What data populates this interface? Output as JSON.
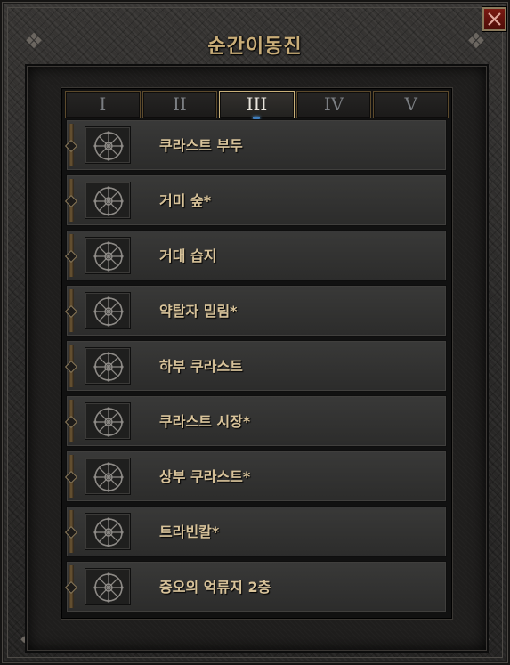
{
  "window": {
    "title": "순간이동진",
    "close_label": "×"
  },
  "tabs": [
    {
      "label": "I",
      "active": false
    },
    {
      "label": "II",
      "active": false
    },
    {
      "label": "III",
      "active": true
    },
    {
      "label": "IV",
      "active": false
    },
    {
      "label": "V",
      "active": false
    }
  ],
  "waypoints": [
    {
      "label": "쿠라스트 부두",
      "icon": "waypoint-icon"
    },
    {
      "label": "거미 숲*",
      "icon": "waypoint-icon"
    },
    {
      "label": "거대 습지",
      "icon": "waypoint-icon"
    },
    {
      "label": "약탈자 밀림*",
      "icon": "waypoint-icon"
    },
    {
      "label": "하부 쿠라스트",
      "icon": "waypoint-icon"
    },
    {
      "label": "쿠라스트 시장*",
      "icon": "waypoint-icon"
    },
    {
      "label": "상부 쿠라스트*",
      "icon": "waypoint-icon"
    },
    {
      "label": "트라빈칼*",
      "icon": "waypoint-icon"
    },
    {
      "label": "증오의 억류지 2층",
      "icon": "waypoint-icon"
    }
  ],
  "colors": {
    "title_gold": "#c9ad78",
    "label_gold": "#d8c39a",
    "active_tab_border": "#c8b07a",
    "close_red": "#7a1a12",
    "indicator_blue": "#3e7dbd"
  }
}
